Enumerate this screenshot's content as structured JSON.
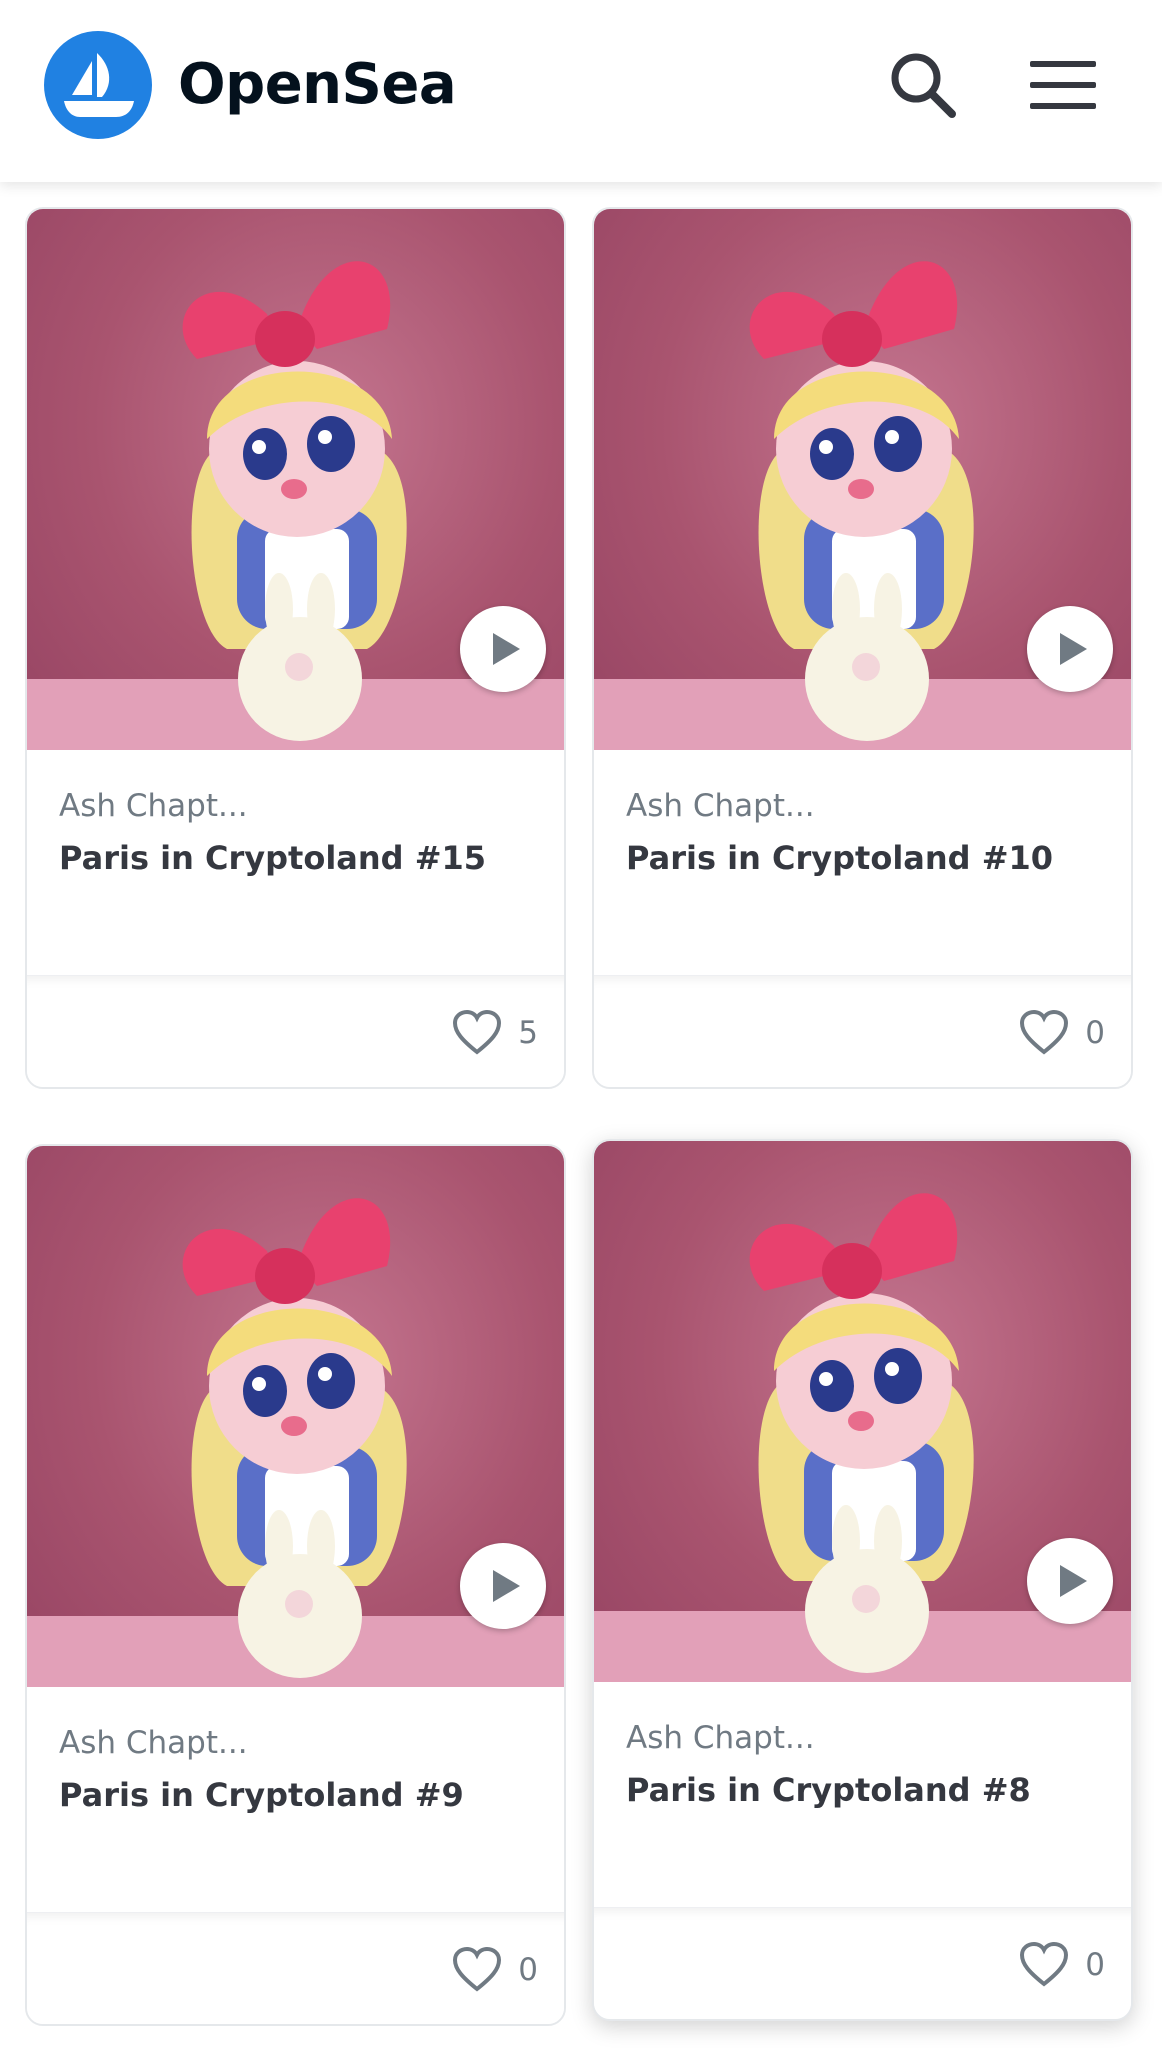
{
  "header": {
    "brand": "OpenSea",
    "logo_icon": "opensea-ship-logo",
    "search_icon": "search-icon",
    "menu_icon": "hamburger-menu-icon",
    "brand_color": "#2081e2"
  },
  "items": [
    {
      "collection": "Ash Chapt...",
      "title": "Paris in Cryptoland #15",
      "likes": "5"
    },
    {
      "collection": "Ash Chapt...",
      "title": "Paris in Cryptoland #10",
      "likes": "0"
    },
    {
      "collection": "Ash Chapt...",
      "title": "Paris in Cryptoland #9",
      "likes": "0"
    },
    {
      "collection": "Ash Chapt...",
      "title": "Paris in Cryptoland #8",
      "likes": "0"
    }
  ]
}
